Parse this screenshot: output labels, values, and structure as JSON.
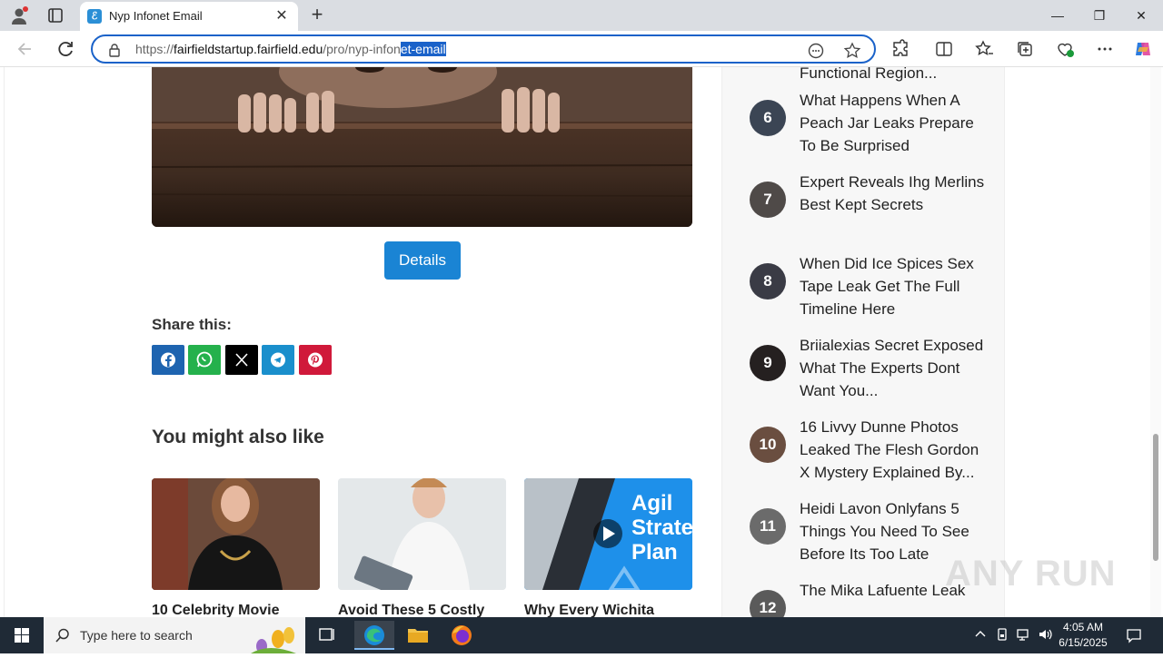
{
  "browser": {
    "tab_title": "Nyp Infonet Email",
    "url_prefix": "https://",
    "url_host": "fairfieldstartup.fairfield.edu",
    "url_path": "/pro/nyp-infon",
    "url_selected": "et-email"
  },
  "main": {
    "details_label": "Details",
    "share_title": "Share this:",
    "share_buttons": [
      "facebook",
      "whatsapp",
      "x",
      "telegram",
      "pinterest"
    ],
    "also_title": "You might also like",
    "cards": [
      {
        "title": "10 Celebrity Movie"
      },
      {
        "title": "Avoid These 5 Costly"
      },
      {
        "title": "Why Every Wichita"
      }
    ],
    "card3_overlay": "Agil Strateg Plan"
  },
  "sidebar": {
    "top_fragment": "Functional Region...",
    "items": [
      {
        "num": "6",
        "text": "What Happens When A Peach Jar Leaks Prepare To Be Surprised"
      },
      {
        "num": "7",
        "text": "Expert Reveals Ihg Merlins Best Kept Secrets"
      },
      {
        "num": "8",
        "text": "When Did Ice Spices Sex Tape Leak Get The Full Timeline Here"
      },
      {
        "num": "9",
        "text": "Briialexias Secret Exposed What The Experts Dont Want You..."
      },
      {
        "num": "10",
        "text": "16 Livvy Dunne Photos Leaked The Flesh Gordon X Mystery Explained By..."
      },
      {
        "num": "11",
        "text": "Heidi Lavon Onlyfans 5 Things You Need To See Before Its Too Late"
      },
      {
        "num": "12",
        "text": "The Mika Lafuente Leak"
      }
    ]
  },
  "watermark": "ANY RUN",
  "taskbar": {
    "search_placeholder": "Type here to search",
    "time": "4:05 AM",
    "date": "6/15/2025"
  }
}
